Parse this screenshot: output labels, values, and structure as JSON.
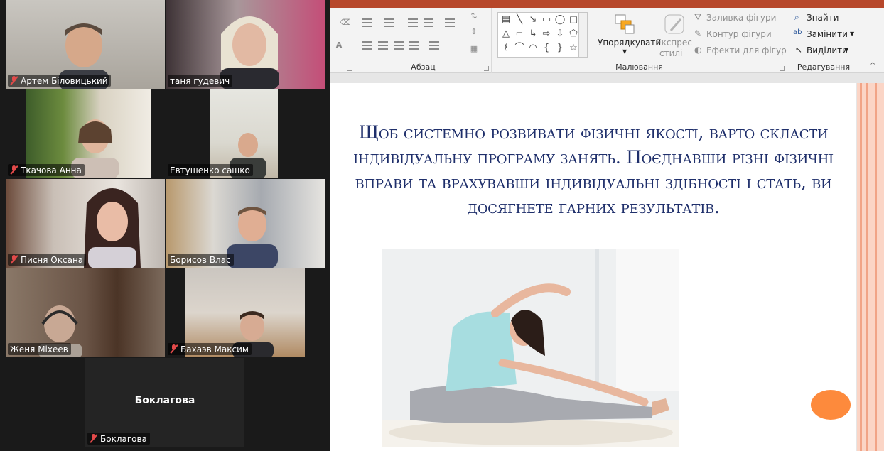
{
  "gallery": {
    "participants": [
      {
        "name": "Артем Біловицький",
        "muted": true
      },
      {
        "name": "таня гудевич",
        "muted": false
      },
      {
        "name": "Ткачова Анна",
        "muted": true
      },
      {
        "name": "Евтушенко сашко",
        "muted": false
      },
      {
        "name": "Писня Оксана",
        "muted": true
      },
      {
        "name": "Борисов Влас",
        "muted": false,
        "speaking": true
      },
      {
        "name": "Женя Міхеев",
        "muted": false
      },
      {
        "name": "Бахаэв Максим",
        "muted": true
      },
      {
        "name": "Боклагова",
        "muted": true,
        "video_off": true,
        "display_label": "Боклагова"
      }
    ]
  },
  "ribbon": {
    "groups": {
      "paragraph": "Абзац",
      "drawing": "Малювання",
      "editing": "Редагування"
    },
    "drawing": {
      "arrange": "Упорядкувати",
      "quick_styles_1": "Експрес-",
      "quick_styles_2": "стилі",
      "shape_fill": "Заливка фігури",
      "shape_outline": "Контур фігури",
      "shape_effects": "Ефекти для фігур"
    },
    "editing": {
      "find": "Знайти",
      "replace": "Замінити",
      "select": "Виділити"
    }
  },
  "slide": {
    "text": "Щоб системно розвивати фізичні якості, варто скласти індивідуальну програму занять. Поєднавши різні фізичні вправи та врахувавши індивідуальні здібності і стать, ви досягнете гарних результатів."
  },
  "colors": {
    "zoom_bg": "#1a1a1a",
    "active_speaker": "#23d959",
    "ppt_accent": "#b7472a",
    "slide_text": "#1f2f6b",
    "slide_stripe": "#fbd5c6",
    "orange_shape": "#fd8a3c"
  }
}
